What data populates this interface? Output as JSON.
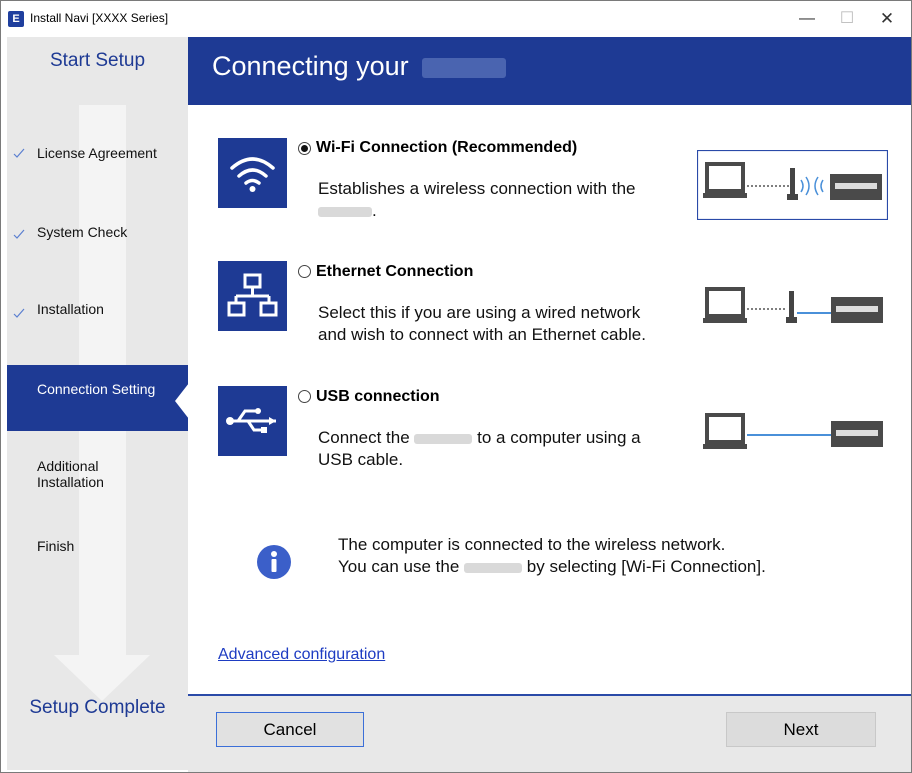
{
  "window": {
    "title": "Install Navi [XXXX Series]",
    "app_icon": "E",
    "minimize_glyph": "—",
    "maximize_glyph": "☐",
    "close_glyph": "✕"
  },
  "sidebar": {
    "title": "Start Setup",
    "steps": [
      {
        "label": "License Agreement",
        "state": "done"
      },
      {
        "label": "System Check",
        "state": "done"
      },
      {
        "label": "Installation",
        "state": "done"
      },
      {
        "label": "Connection Setting",
        "state": "active"
      },
      {
        "label": "Additional Installation",
        "state": "pending"
      },
      {
        "label": "Finish",
        "state": "pending"
      }
    ],
    "footer": "Setup Complete"
  },
  "header": {
    "title": "Connecting your"
  },
  "options": [
    {
      "title": "Wi-Fi Connection (Recommended)",
      "selected": true,
      "description_line1": "Establishes a wireless connection with the",
      "description_line2_suffix": ".",
      "icon": "wifi-icon"
    },
    {
      "title": "Ethernet Connection",
      "selected": false,
      "description_line1": "Select this if you are using a wired network",
      "description_line2": "and wish to connect with an Ethernet cable.",
      "icon": "ethernet-icon"
    },
    {
      "title": "USB connection",
      "selected": false,
      "description_line1_prefix": "Connect the",
      "description_line1_suffix": "to a computer using a",
      "description_line2": "USB cable.",
      "icon": "usb-icon"
    }
  ],
  "info": {
    "line1": "The computer is connected to the wireless network.",
    "line2_prefix": "You can use the",
    "line2_suffix": "by selecting [Wi-Fi Connection].",
    "icon": "info-icon"
  },
  "links": {
    "advanced": "Advanced configuration"
  },
  "buttons": {
    "cancel": "Cancel",
    "next": "Next"
  },
  "colors": {
    "brand_blue": "#1e3a94",
    "link_blue": "#1e3cc2",
    "panel_gray": "#e8e8e8"
  }
}
